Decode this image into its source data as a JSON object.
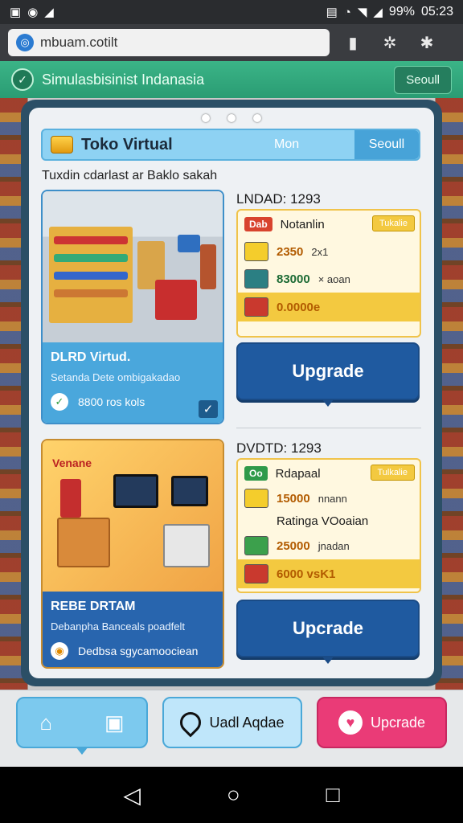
{
  "status_bar": {
    "left_icons": [
      "image-icon",
      "app-icon",
      "signal-app-icon"
    ],
    "battery": "99%",
    "time": "05:23"
  },
  "browser": {
    "url": "mbuam.cotilt"
  },
  "app_header": {
    "title": "Simulasbisinist Indanasia",
    "button": "Seoull"
  },
  "modal": {
    "header_title": "Toko Virtual",
    "header_tab": "Mon",
    "header_button": "Seoull",
    "subtitle": "Tuxdin cdarlast ar Baklo sakah",
    "store1": {
      "name": "DLRD Virtud.",
      "desc": "Setanda  Dete ombigakadao",
      "meta": "8800 ros kols",
      "stats_title": "LNDAD: 1293",
      "badge": "Dab",
      "ribbon": "Tukalie",
      "row1_label": "Notanlin",
      "row2_value": "2350",
      "row2_extra": "2x1",
      "row3_value": "83000",
      "row3_extra": "× aoan",
      "total_badge": "0",
      "total_value": "0.0000e",
      "button": "Upgrade"
    },
    "store2": {
      "name": "REBE DRTAM",
      "desc": "Debanpha Banceals poadfelt",
      "meta": "Dedbsa sgycamoociean",
      "badge_label": "Venane",
      "stats_title": "DVDTD: 1293",
      "badge": "Oo",
      "ribbon": "Tulkalie",
      "row1_label": "Rdapaal",
      "row2_value": "15000",
      "row2_extra": "nnann",
      "row3_label": "Ratinga VOoaian",
      "row4_value": "25000",
      "row4_extra": "jnadan",
      "total_value": "6000 vsK1",
      "button": "Upcrade"
    }
  },
  "bottom_nav": {
    "middle_label": "Uadl Aqdae",
    "right_label": "Upcrade"
  },
  "colors": {
    "header_green": "#3bb487",
    "modal_frame": "#2b4f66",
    "upgrade_blue": "#1f5aa0",
    "stat_gold": "#f3c940",
    "pink": "#ea3b77"
  }
}
